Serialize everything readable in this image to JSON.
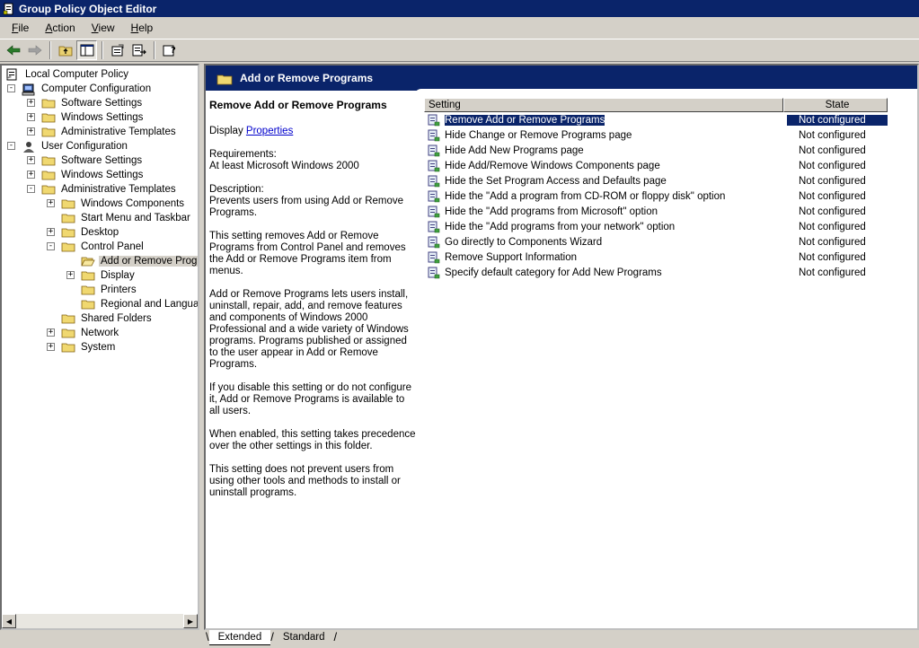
{
  "window": {
    "title": "Group Policy Object Editor"
  },
  "menu": [
    "File",
    "Action",
    "View",
    "Help"
  ],
  "toolbar": {
    "buttons": [
      "back-arrow-icon",
      "forward-arrow-icon",
      "up-folder-icon",
      "show-hide-tree-icon",
      "properties-icon",
      "export-list-icon",
      "help-icon"
    ]
  },
  "tree": {
    "root": "Local Computer Policy",
    "items": [
      {
        "label": "Computer Configuration",
        "icon": "computer-icon"
      },
      {
        "label": "Software Settings"
      },
      {
        "label": "Windows Settings"
      },
      {
        "label": "Administrative Templates"
      },
      {
        "label": "User Configuration",
        "icon": "user-icon"
      },
      {
        "label": "Software Settings"
      },
      {
        "label": "Windows Settings"
      },
      {
        "label": "Administrative Templates"
      },
      {
        "label": "Windows Components"
      },
      {
        "label": "Start Menu and Taskbar"
      },
      {
        "label": "Desktop"
      },
      {
        "label": "Control Panel"
      },
      {
        "label": "Add or Remove Programs",
        "selected": true
      },
      {
        "label": "Display"
      },
      {
        "label": "Printers"
      },
      {
        "label": "Regional and Language Options"
      },
      {
        "label": "Shared Folders"
      },
      {
        "label": "Network"
      },
      {
        "label": "System"
      }
    ]
  },
  "right_pane": {
    "header": "Add or Remove Programs",
    "description": {
      "title": "Remove Add or Remove Programs",
      "display_label": "Display ",
      "display_link": "Properties",
      "requirements_label": "Requirements:",
      "requirements": "At least Microsoft Windows 2000",
      "description_label": "Description:",
      "description": "Prevents users from using Add or Remove Programs.",
      "p1": "This setting removes Add or Remove Programs from Control Panel and removes the Add or Remove Programs item from menus.",
      "p2": "Add or Remove Programs lets users install, uninstall, repair, add, and remove features and components of Windows 2000 Professional and a wide variety of Windows programs. Programs published or assigned to the user appear in Add or Remove Programs.",
      "p3": "If you disable this setting or do not configure it, Add or Remove Programs is available to all users.",
      "p4": "When enabled, this setting takes precedence over the other settings in this folder.",
      "p5": "This setting does not prevent users from using other tools and methods to install or uninstall programs."
    },
    "columns": {
      "setting": "Setting",
      "state": "State"
    },
    "rows": [
      {
        "setting": "Remove Add or Remove Programs",
        "state": "Not configured",
        "selected": true
      },
      {
        "setting": "Hide Change or Remove Programs page",
        "state": "Not configured"
      },
      {
        "setting": "Hide Add New Programs page",
        "state": "Not configured"
      },
      {
        "setting": "Hide Add/Remove Windows Components page",
        "state": "Not configured"
      },
      {
        "setting": "Hide the Set Program Access and Defaults page",
        "state": "Not configured"
      },
      {
        "setting": "Hide the \"Add a program from CD-ROM or floppy disk\" option",
        "state": "Not configured"
      },
      {
        "setting": "Hide the \"Add programs from Microsoft\" option",
        "state": "Not configured"
      },
      {
        "setting": "Hide the \"Add programs from your network\" option",
        "state": "Not configured"
      },
      {
        "setting": "Go directly to Components Wizard",
        "state": "Not configured"
      },
      {
        "setting": "Remove Support Information",
        "state": "Not configured"
      },
      {
        "setting": "Specify default category for Add New Programs",
        "state": "Not configured"
      }
    ]
  },
  "tabs": [
    "Extended",
    "Standard"
  ],
  "colors": {
    "title_bar": "#0a246a",
    "selection": "#0a246a",
    "face": "#d4d0c8"
  }
}
